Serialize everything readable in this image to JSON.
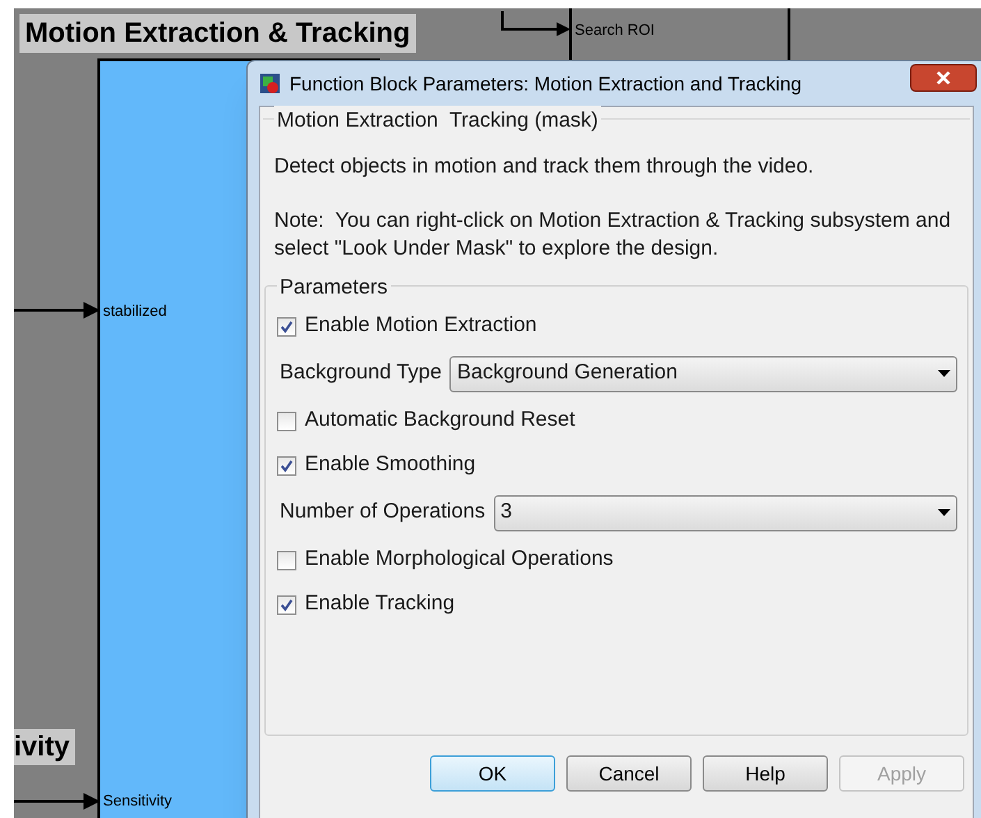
{
  "diagram": {
    "title": "Motion Extraction & Tracking",
    "side_label": "ivity",
    "ports": [
      {
        "label": "Search ROI"
      },
      {
        "label": "stabilized"
      },
      {
        "label": "Sensitivity"
      }
    ]
  },
  "dialog": {
    "title": "Function Block Parameters: Motion Extraction and Tracking",
    "mask": {
      "heading": "Motion Extraction  Tracking (mask)",
      "description": "Detect objects in motion and track them through the video.",
      "note": "Note:  You can right-click on Motion Extraction & Tracking subsystem and select \"Look Under Mask\" to explore the design."
    },
    "parameters": {
      "heading": "Parameters",
      "items": [
        {
          "kind": "checkbox",
          "label": "Enable Motion Extraction",
          "checked": true
        },
        {
          "kind": "dropdown",
          "label": "Background Type",
          "value": "Background Generation"
        },
        {
          "kind": "checkbox",
          "label": "Automatic Background Reset",
          "checked": false
        },
        {
          "kind": "checkbox",
          "label": "Enable Smoothing",
          "checked": true
        },
        {
          "kind": "dropdown",
          "label": "Number of Operations",
          "value": "3"
        },
        {
          "kind": "checkbox",
          "label": "Enable Morphological Operations",
          "checked": false
        },
        {
          "kind": "checkbox",
          "label": "Enable Tracking",
          "checked": true
        }
      ]
    },
    "buttons": [
      {
        "label": "OK",
        "default": true,
        "disabled": false
      },
      {
        "label": "Cancel",
        "default": false,
        "disabled": false
      },
      {
        "label": "Help",
        "default": false,
        "disabled": false
      },
      {
        "label": "Apply",
        "default": false,
        "disabled": true
      }
    ]
  }
}
